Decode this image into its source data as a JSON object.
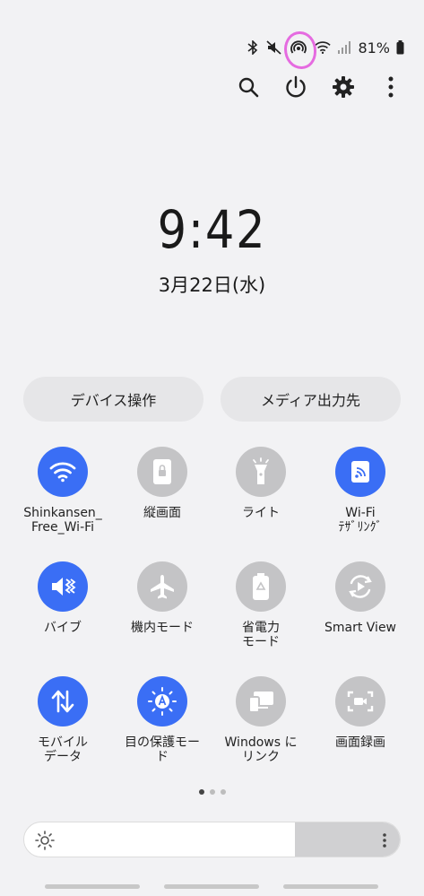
{
  "status_bar": {
    "icons": [
      "bluetooth-icon",
      "mute-icon",
      "hotspot-icon",
      "wifi-icon",
      "signal-icon",
      "battery-icon"
    ],
    "battery_percent": "81%",
    "annotation_color": "#e56be0"
  },
  "top_actions": [
    "search-icon",
    "power-icon",
    "gear-icon",
    "more-vertical-icon"
  ],
  "clock": {
    "time": "9:42",
    "date": "3月22日(水)"
  },
  "pills": {
    "left": "デバイス操作",
    "right": "メディア出力先"
  },
  "tiles": [
    {
      "label": "Shinkansen_\nFree_Wi-Fi",
      "icon": "wifi-icon",
      "active": true
    },
    {
      "label": "縦画面",
      "icon": "portrait-lock-icon",
      "active": false
    },
    {
      "label": "ライト",
      "icon": "flashlight-icon",
      "active": false
    },
    {
      "label": "Wi-Fi\nﾃｻﾞﾘﾝｸﾞ",
      "icon": "hotspot-icon",
      "active": true
    },
    {
      "label": "バイブ",
      "icon": "vibrate-icon",
      "active": true
    },
    {
      "label": "機内モード",
      "icon": "airplane-icon",
      "active": false
    },
    {
      "label": "省電力\nモード",
      "icon": "power-saving-icon",
      "active": false
    },
    {
      "label": "Smart View",
      "icon": "smart-view-icon",
      "active": false
    },
    {
      "label": "モバイル\nデータ",
      "icon": "mobile-data-icon",
      "active": true
    },
    {
      "label": "目の保護モー\nド",
      "icon": "eye-comfort-icon",
      "active": true
    },
    {
      "label": "Windows に\nリンク",
      "icon": "link-to-windows-icon",
      "active": false
    },
    {
      "label": "画面録画",
      "icon": "screen-record-icon",
      "active": false
    }
  ],
  "page_indicator": {
    "pages": 3,
    "current": 1
  },
  "brightness": {
    "level": 0.72
  },
  "colors": {
    "accent": "#3a6ef5",
    "tile_off": "#c4c4c6",
    "background": "#f2f2f4"
  }
}
